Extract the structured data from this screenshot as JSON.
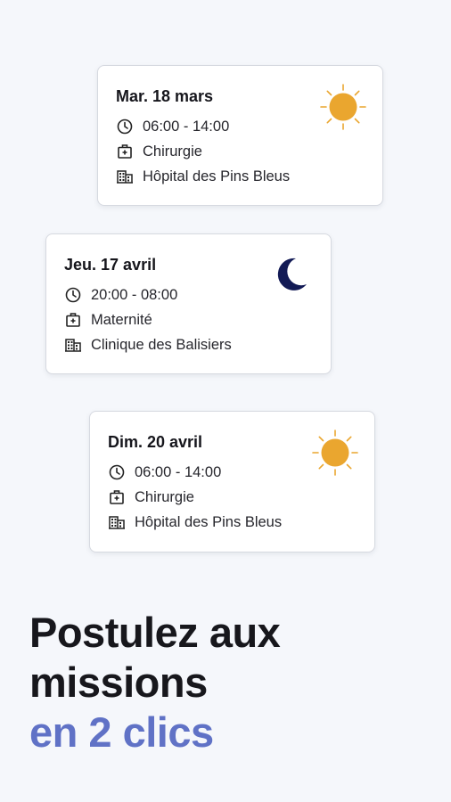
{
  "cards": [
    {
      "date": "Mar. 18 mars",
      "time": "06:00 - 14:00",
      "service": "Chirurgie",
      "place": "Hôpital des Pins Bleus",
      "shift_icon": "sun-icon"
    },
    {
      "date": "Jeu. 17 avril",
      "time": "20:00 - 08:00",
      "service": "Maternité",
      "place": "Clinique des Balisiers",
      "shift_icon": "moon-icon"
    },
    {
      "date": "Dim. 20 avril",
      "time": "06:00 - 14:00",
      "service": "Chirurgie",
      "place": "Hôpital des Pins Bleus",
      "shift_icon": "sun-icon"
    }
  ],
  "headline": {
    "line1": "Postulez aux",
    "line2": "missions",
    "line3": "en 2 clics"
  },
  "colors": {
    "background": "#f5f7fb",
    "accent": "#6072c6",
    "sun": "#eaa62f",
    "moon": "#121a55"
  }
}
